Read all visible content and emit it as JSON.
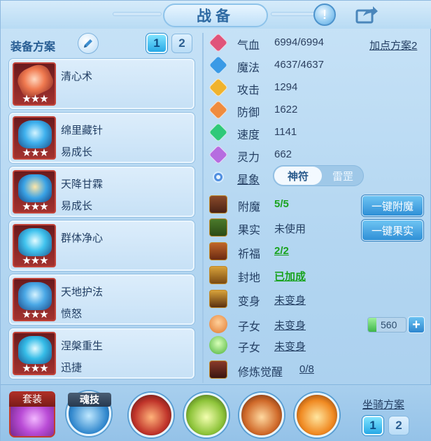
{
  "window": {
    "title": "战备"
  },
  "header": {
    "help_icon": "exclamation-icon",
    "share_icon": "share-icon"
  },
  "left": {
    "heading": "装备方案",
    "plan_tabs": [
      "1",
      "2"
    ],
    "cards": [
      {
        "name": "清心术",
        "sub": "",
        "stars": "★★★"
      },
      {
        "name": "绵里藏针",
        "sub": "易成长",
        "stars": "★★★"
      },
      {
        "name": "天降甘霖",
        "sub": "易成长",
        "stars": "★★★"
      },
      {
        "name": "群体净心",
        "sub": "",
        "stars": "★★★"
      },
      {
        "name": "天地护法",
        "sub": "愤怒",
        "stars": "★★★"
      },
      {
        "name": "涅槃重生",
        "sub": "迅捷",
        "stars": "★★★"
      }
    ]
  },
  "stats": {
    "plan_link": "加点方案2",
    "rows": [
      {
        "label": "气血",
        "value": "6994/6994",
        "color": "#e0547a"
      },
      {
        "label": "魔法",
        "value": "4637/4637",
        "color": "#3a9ae6"
      },
      {
        "label": "攻击",
        "value": "1294",
        "color": "#f0b32d"
      },
      {
        "label": "防御",
        "value": "1622",
        "color": "#ef8c3e"
      },
      {
        "label": "速度",
        "value": "1141",
        "color": "#2fc979"
      },
      {
        "label": "灵力",
        "value": "662",
        "color": "#b66ce0"
      }
    ],
    "star_label": "星象",
    "toggle": {
      "on": "神符",
      "off": "雷罡"
    }
  },
  "features": [
    {
      "label": "附魔",
      "value": "5/5",
      "style": "green"
    },
    {
      "label": "果实",
      "value": "未使用",
      "style": ""
    },
    {
      "label": "祈福",
      "value": "2/2",
      "style": "green ul"
    },
    {
      "label": "封地",
      "value": "已加成",
      "style": "green ul"
    },
    {
      "label": "变身",
      "value": "未变身",
      "style": "ul"
    },
    {
      "label": "子女",
      "value": "未变身",
      "style": "ul"
    },
    {
      "label": "子女",
      "value": "未变身",
      "style": "ul"
    },
    {
      "label": "修炼觉醒",
      "value": "0/8",
      "style": "ul"
    }
  ],
  "actions": {
    "enchant": "一键附魔",
    "fruit": "一键果实"
  },
  "child_counter": {
    "value": "560",
    "plus": "+"
  },
  "bottom": {
    "set_label": "套装",
    "soul_label": "魂技",
    "mount_label": "坐骑方案",
    "mount_tabs": [
      "1",
      "2"
    ]
  }
}
